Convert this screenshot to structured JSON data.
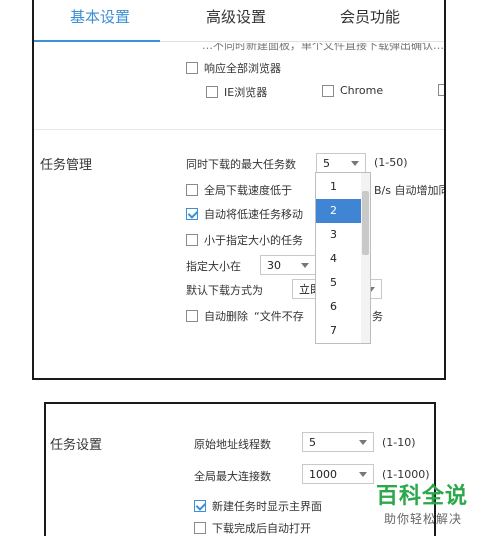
{
  "tabs": [
    {
      "label": "基本设置",
      "active": true
    },
    {
      "label": "高级设置",
      "active": false
    },
    {
      "label": "会员功能",
      "active": false
    }
  ],
  "browser_section": {
    "cut_text": "…不同时新建面板，单个文件直接下载弹出确认…",
    "respond_all": {
      "label": "响应全部浏览器",
      "checked": false
    },
    "ie": {
      "label": "IE浏览器",
      "checked": false
    },
    "chrome": {
      "label": "Chrome",
      "checked": false
    }
  },
  "task_mgmt": {
    "title": "任务管理",
    "max_tasks_label": "同时下载的最大任务数",
    "max_tasks_value": "5",
    "max_tasks_range": "(1-50)",
    "speed_low": {
      "label": "全局下载速度低于",
      "suffix": "B/s 自动增加同时",
      "checked": false
    },
    "auto_move": {
      "label": "自动将低速任务移动",
      "checked": true
    },
    "min_size": {
      "label": "小于指定大小的任务",
      "checked": false
    },
    "size_label": "指定大小在",
    "size_value": "30",
    "download_mode_label": "默认下载方式为",
    "download_mode_value": "立即",
    "auto_delete": {
      "label": "自动删除",
      "mid": "“文件不存",
      "tail": "务",
      "checked": false
    }
  },
  "dropdown": {
    "options": [
      "1",
      "2",
      "3",
      "4",
      "5",
      "6",
      "7"
    ],
    "selected_index": 1
  },
  "task_settings": {
    "title": "任务设置",
    "threads_label": "原始地址线程数",
    "threads_value": "5",
    "threads_range": "(1-10)",
    "connections_label": "全局最大连接数",
    "connections_value": "1000",
    "connections_range": "(1-1000)",
    "show_main": {
      "label": "新建任务时显示主界面",
      "checked": true
    },
    "auto_open": {
      "label": "下载完成后自动打开",
      "checked": false
    }
  },
  "watermark": {
    "main": "百科全说",
    "sub": "助你轻松解决"
  },
  "colors": {
    "accent": "#3d8fd6",
    "selected_bg": "#3f85d4",
    "watermark_green": "#2aa84a"
  }
}
